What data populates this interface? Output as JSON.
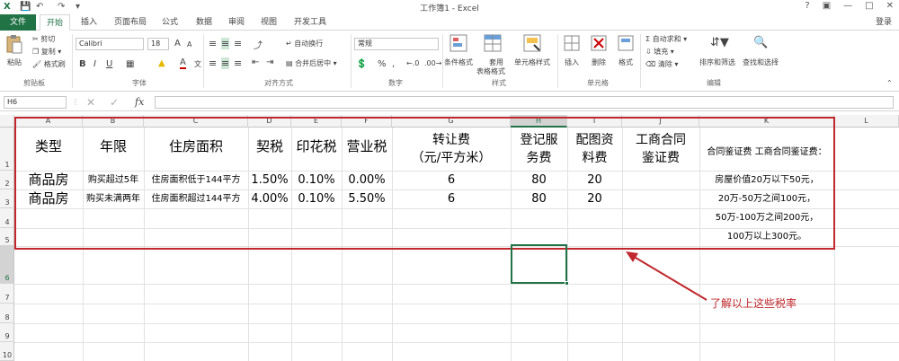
{
  "window": {
    "title": "工作簿1 - Excel",
    "login": "登录"
  },
  "tabs": [
    "文件",
    "开始",
    "插入",
    "页面布局",
    "公式",
    "数据",
    "审阅",
    "视图",
    "开发工具"
  ],
  "ribbon": {
    "clipboard": {
      "paste": "粘贴",
      "cut": "剪切",
      "copy": "复制",
      "format_painter": "格式刷",
      "label": "剪贴板"
    },
    "font": {
      "name": "Calibri",
      "size": "18",
      "bold": "B",
      "italic": "I",
      "underline": "U",
      "grow": "A",
      "shrink": "A",
      "color_a": "A",
      "wen": "文",
      "label": "字体"
    },
    "alignment": {
      "wrap": "自动换行",
      "merge": "合并后居中",
      "label": "对齐方式"
    },
    "number": {
      "format": "常规",
      "percent": "%",
      "comma": ",",
      "label": "数字"
    },
    "styles": {
      "cond": "条件格式",
      "table1": "套用",
      "table2": "表格格式",
      "cell": "单元格样式",
      "label": "样式"
    },
    "cells": {
      "insert": "插入",
      "delete": "删除",
      "format": "格式",
      "label": "单元格"
    },
    "editing": {
      "autosum": "自动求和",
      "fill": "填充",
      "clear": "清除",
      "sort": "排序和筛选",
      "find": "查找和选择",
      "label": "编辑"
    }
  },
  "formula_bar": {
    "name_box": "H6",
    "fx": "fx",
    "content": ""
  },
  "columns": [
    "A",
    "B",
    "C",
    "D",
    "E",
    "F",
    "G",
    "H",
    "I",
    "J",
    "K",
    "L"
  ],
  "rows": [
    "1",
    "2",
    "3",
    "4",
    "5",
    "6",
    "7",
    "8",
    "9",
    "10"
  ],
  "sheet": {
    "headers": {
      "A": "类型",
      "B": "年限",
      "C": "住房面积",
      "D": "契税",
      "E": "印花税",
      "F": "营业税",
      "G1": "转让费",
      "G2": "（元/平方米）",
      "H1": "登记服",
      "H2": "务费",
      "I1": "配图资",
      "I2": "料费",
      "J1": "工商合同",
      "J2": "鉴证费",
      "K": "合同鉴证费 工商合同鉴证费："
    },
    "row2": {
      "A": "商品房",
      "B": "购买超过5年",
      "C": "住房面积低于144平方",
      "D": "1.50%",
      "E": "0.10%",
      "F": "0.00%",
      "G": "6",
      "H": "80",
      "I": "20",
      "K": "房屋价值20万以下50元，"
    },
    "row3": {
      "A": "商品房",
      "B": "购买未满两年",
      "C": "住房面积超过144平方",
      "D": "4.00%",
      "E": "0.10%",
      "F": "5.50%",
      "G": "6",
      "H": "80",
      "I": "20",
      "K": "20万-50万之间100元，"
    },
    "row4": {
      "K": "50万-100万之间200元，"
    },
    "row5": {
      "K": "100万以上300元。"
    }
  },
  "annotation": {
    "note": "了解以上这些税率",
    "color": "#c0282d"
  },
  "colors": {
    "accent": "#217346"
  }
}
